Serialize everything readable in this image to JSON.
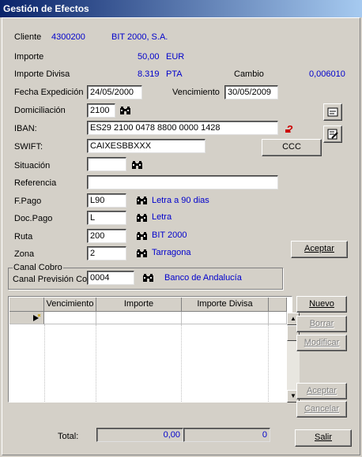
{
  "window": {
    "title": "Gestión de Efectos"
  },
  "cliente": {
    "label": "Cliente",
    "code": "4300200",
    "name": "BIT 2000, S.A."
  },
  "importe": {
    "label": "Importe",
    "value": "50,00",
    "currency": "EUR"
  },
  "importe_divisa": {
    "label": "Importe Divisa",
    "value": "8.319",
    "currency": "PTA"
  },
  "cambio": {
    "label": "Cambio",
    "value": "0,006010"
  },
  "fecha_expedicion": {
    "label": "Fecha Expedición",
    "value": "24/05/2000"
  },
  "vencimiento": {
    "label": "Vencimiento",
    "value": "30/05/2009"
  },
  "domiciliacion": {
    "label": "Domiciliación",
    "value": "2100"
  },
  "iban": {
    "label": "IBAN:",
    "value": "ES29 2100 0478 8800 0000 1428"
  },
  "swift": {
    "label": "SWIFT:",
    "value": "CAIXESBBXXX"
  },
  "ccc_button": "CCC",
  "situacion": {
    "label": "Situación",
    "value": ""
  },
  "referencia": {
    "label": "Referencia",
    "value": ""
  },
  "fpago": {
    "label": "F.Pago",
    "value": "L90",
    "desc": "Letra a 90 dias"
  },
  "docpago": {
    "label": "Doc.Pago",
    "value": "L",
    "desc": "Letra"
  },
  "ruta": {
    "label": "Ruta",
    "value": "200",
    "desc": "BIT 2000"
  },
  "zona": {
    "label": "Zona",
    "value": "2",
    "desc": "Tarragona"
  },
  "aceptar_top": "Aceptar",
  "canal_cobro": {
    "group_label": "Canal Cobro",
    "label": "Canal Previsión Cob",
    "value": "0004",
    "desc": "Banco de Andalucía"
  },
  "grid": {
    "headers": [
      "Vencimiento",
      "Importe",
      "Importe Divisa"
    ]
  },
  "side_buttons": {
    "nuevo": "Nuevo",
    "borrar": "Borrar",
    "modificar": "Modificar",
    "aceptar": "Aceptar",
    "cancelar": "Cancelar"
  },
  "total": {
    "label": "Total:",
    "importe": "0,00",
    "divisa": "0"
  },
  "salir": "Salir"
}
